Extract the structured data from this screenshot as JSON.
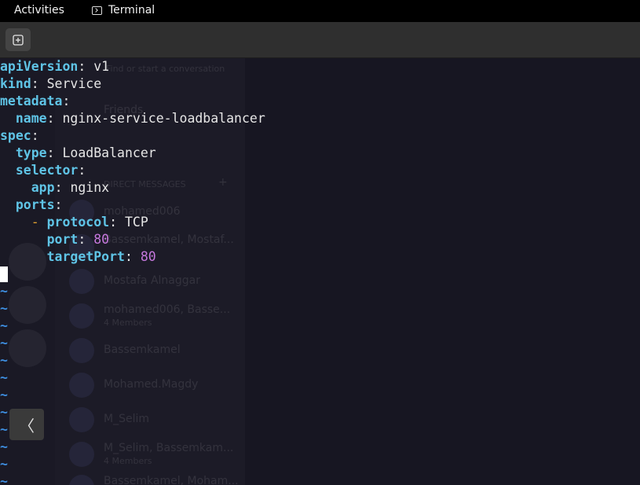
{
  "topbar": {
    "activities_label": "Activities",
    "app_name": "Terminal",
    "app_icon": "terminal-icon"
  },
  "headerbar": {
    "new_tab_icon": "new-tab-icon"
  },
  "editor": {
    "line1_key": "apiVersion",
    "line1_value": "v1",
    "line2_key": "kind",
    "line2_value": "Service",
    "line3_key": "metadata",
    "line4_key": "name",
    "line4_value": "nginx-service-loadbalancer",
    "line5_key": "spec",
    "line6_key": "type",
    "line6_value": "LoadBalancer",
    "line7_key": "selector",
    "line8_key": "app",
    "line8_value": "nginx",
    "line9_key": "ports",
    "line10_dash": "-",
    "line10_key": "protocol",
    "line10_value": "TCP",
    "line11_key": "port",
    "line11_value": "80",
    "line12_key": "targetPort",
    "line12_value": "80",
    "empty_line_marker": "~",
    "colon": ":"
  },
  "background_app": {
    "search_text": "Find or start a conversation",
    "friends_label": "Friends",
    "section_label": "DIRECT MESSAGES",
    "dm_items": [
      {
        "name": "mohamed006"
      },
      {
        "name": "Bassemkamel, Mostaf..."
      },
      {
        "name": "Mostafa Alnaggar"
      },
      {
        "name": "mohamed006, Basse...",
        "sub": "4 Members"
      },
      {
        "name": "Bassemkamel"
      },
      {
        "name": "Mohamed.Magdy"
      },
      {
        "name": "M_Selim"
      },
      {
        "name": "M_Selim, Bassemkam...",
        "sub": "4 Members"
      },
      {
        "name": "Bassemkamel, Moham..."
      }
    ]
  },
  "collapse_button": {
    "label": "〈"
  },
  "colors": {
    "topbar": "#000000",
    "headerbar": "#2f2f2f",
    "terminal_bg": "#171622",
    "yaml_key": "#5fc4e6",
    "yaml_number": "#c678dd",
    "yaml_dash": "#e0a030",
    "tilde": "#3e8ee0"
  }
}
